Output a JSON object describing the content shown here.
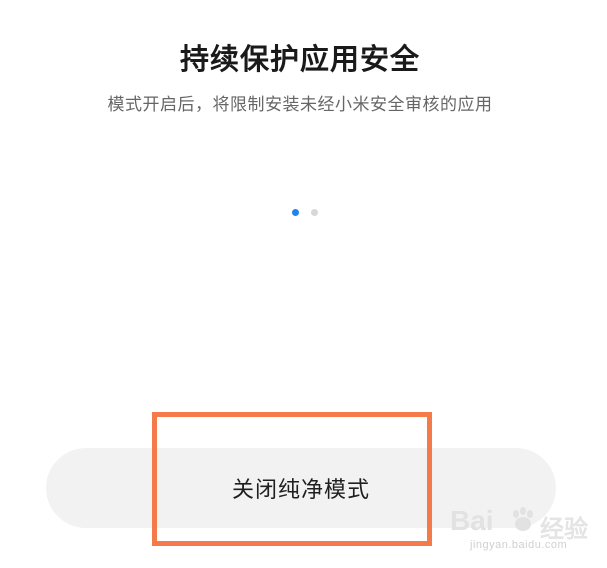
{
  "title": "持续保护应用安全",
  "subtitle": "模式开启后，将限制安装未经小米安全审核的应用",
  "pager": {
    "count": 2,
    "active_index": 0
  },
  "button": {
    "label": "关闭纯净模式"
  },
  "colors": {
    "accent": "#1f84f3",
    "highlight_box": "#f47a4a",
    "button_bg": "#f2f2f2"
  },
  "watermark": {
    "brand": "Bai",
    "brand_cn": "经验",
    "url": "jingyan.baidu.com"
  }
}
